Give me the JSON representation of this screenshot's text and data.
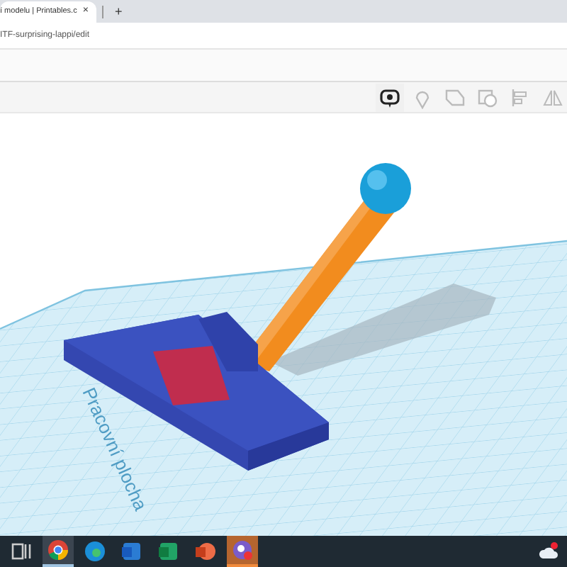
{
  "browser": {
    "tab_title": "í modelu | Printables.c",
    "tab_close": "×",
    "new_tab": "+",
    "address": "ITF-surprising-lappi/edit"
  },
  "toolbar": {
    "tools": [
      {
        "kind": "note",
        "selected": true
      },
      {
        "kind": "pin",
        "selected": false
      },
      {
        "kind": "shape",
        "selected": false
      },
      {
        "kind": "group",
        "selected": false
      },
      {
        "kind": "align",
        "selected": false
      },
      {
        "kind": "mirror",
        "selected": false
      }
    ]
  },
  "viewport": {
    "plane_label": "Pracovní plocha"
  },
  "taskbar": {
    "apps": [
      {
        "kind": "taskview",
        "active": false
      },
      {
        "kind": "chrome",
        "active": true
      },
      {
        "kind": "edge",
        "active": false
      },
      {
        "kind": "word",
        "active": false
      },
      {
        "kind": "excel",
        "active": false
      },
      {
        "kind": "powerpoint",
        "active": false
      },
      {
        "kind": "app",
        "active": true
      }
    ]
  }
}
